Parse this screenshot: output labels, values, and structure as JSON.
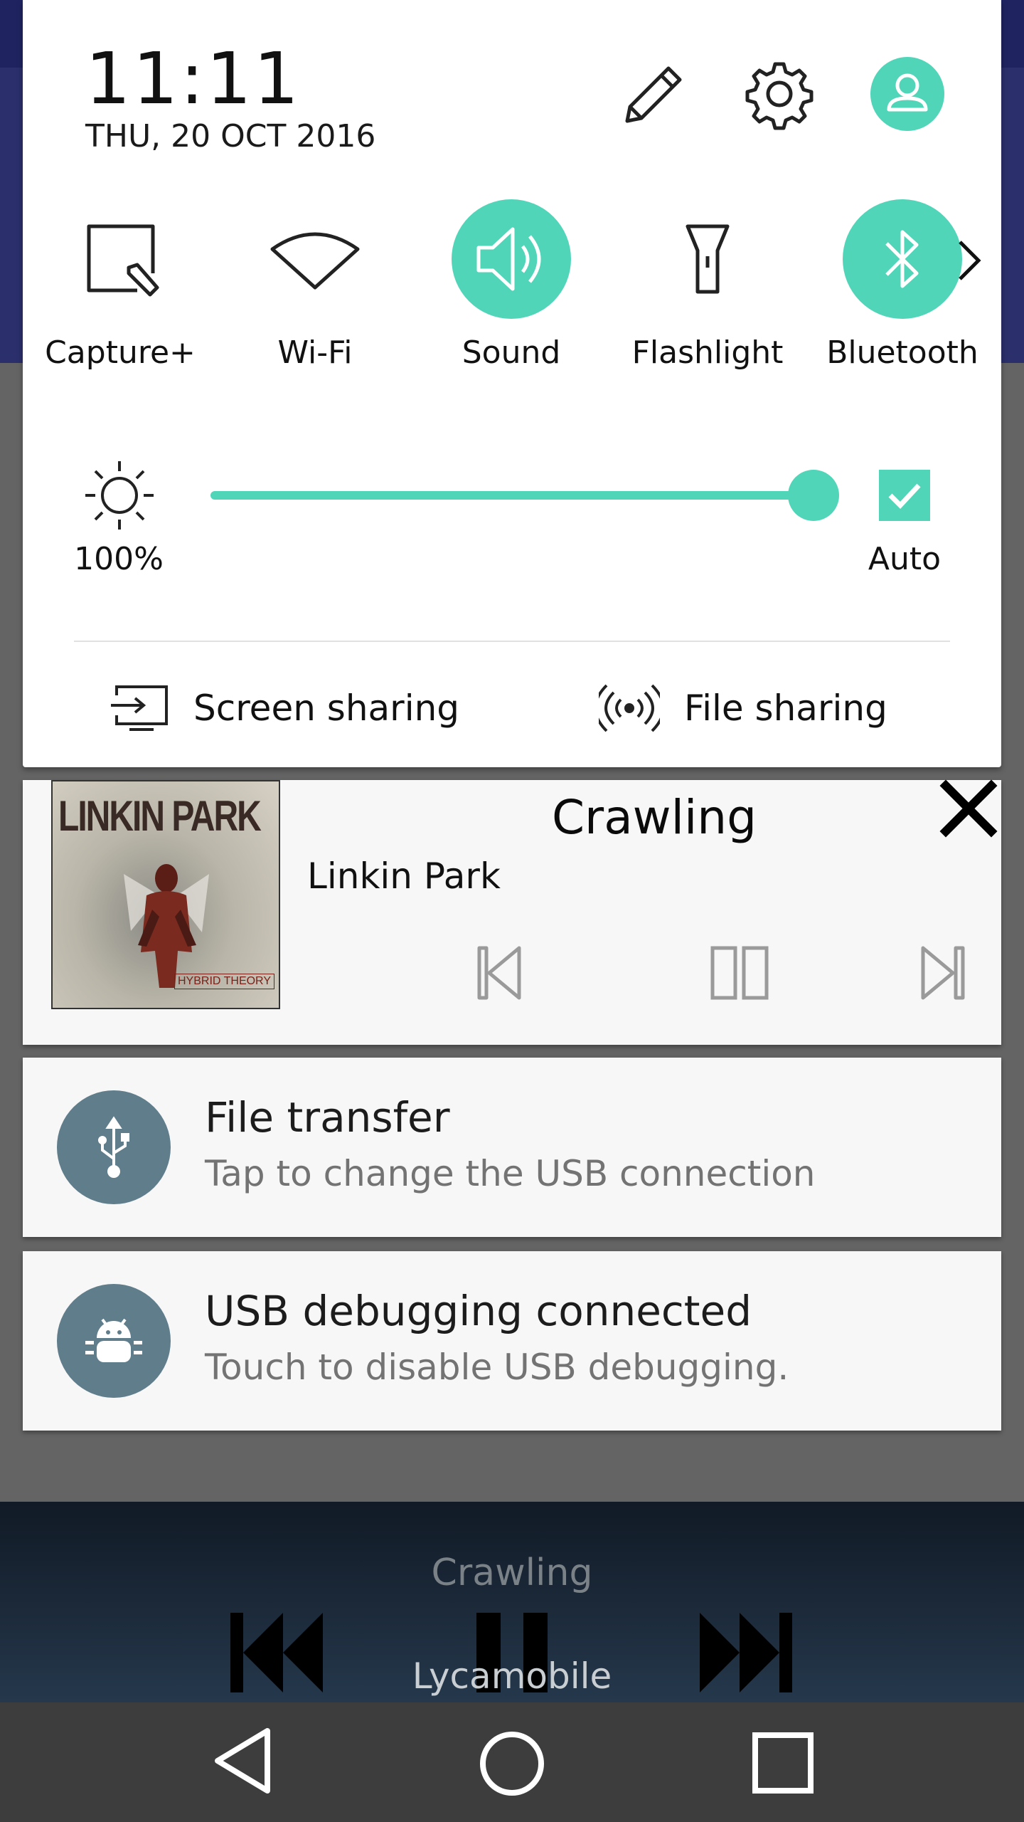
{
  "status": {
    "time": "11:11",
    "date": "THU, 20 OCT 2016"
  },
  "header_icons": [
    "edit-pencil-icon",
    "settings-gear-icon",
    "user-profile-icon"
  ],
  "quick_tiles": [
    {
      "label": "Capture+",
      "icon": "capture-plus-icon",
      "active": false
    },
    {
      "label": "Wi-Fi",
      "icon": "wifi-icon",
      "active": false
    },
    {
      "label": "Sound",
      "icon": "speaker-icon",
      "active": true
    },
    {
      "label": "Flashlight",
      "icon": "flashlight-icon",
      "active": false
    },
    {
      "label": "Bluetooth",
      "icon": "bluetooth-icon",
      "active": true
    }
  ],
  "brightness": {
    "value_label": "100%",
    "level": 1.0,
    "auto_label": "Auto",
    "auto_checked": true
  },
  "sharing": {
    "screen_label": "Screen sharing",
    "file_label": "File sharing"
  },
  "media": {
    "song": "Crawling",
    "artist": "Linkin Park",
    "album_art_text": "LINKIN PARK",
    "album_art_subtext": "HYBRID THEORY"
  },
  "notifications": [
    {
      "title": "File transfer",
      "text": "Tap to change the USB connection",
      "icon": "usb-icon"
    },
    {
      "title": "USB debugging connected",
      "text": "Touch to disable USB debugging.",
      "icon": "android-bug-icon"
    }
  ],
  "background_app": {
    "song": "Crawling",
    "carrier": "Lycamobile"
  },
  "colors": {
    "accent": "#50d5b9",
    "notification_icon_bg": "#607d8b",
    "nav_bar": "#3d3d3d"
  }
}
